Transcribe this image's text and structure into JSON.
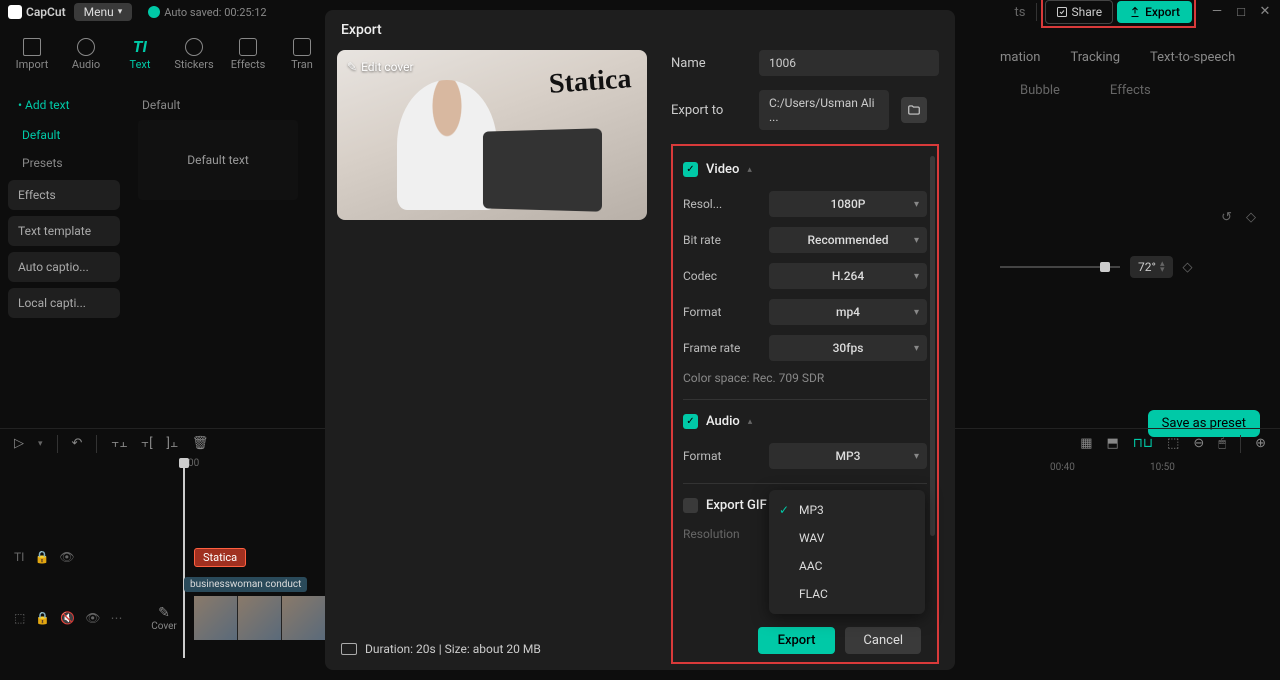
{
  "app": {
    "name": "CapCut",
    "menu": "Menu",
    "auto_saved": "Auto saved: 00:25:12"
  },
  "topbar": {
    "share": "Share",
    "export": "Export"
  },
  "tabs": {
    "import": "Import",
    "audio": "Audio",
    "text": "Text",
    "stickers": "Stickers",
    "effects": "Effects",
    "transitions": "Tran"
  },
  "text_side": {
    "add": "• Add text",
    "default_sub": "Default",
    "presets_sub": "Presets",
    "effects": "Effects",
    "template": "Text template",
    "auto": "Auto captio...",
    "local": "Local capti...",
    "preview_title": "Default",
    "preview_text": "Default text"
  },
  "right": {
    "tab1": "mation",
    "tab2": "Tracking",
    "tab3": "Text-to-speech",
    "sub1": "Bubble",
    "sub2": "Effects",
    "angle": "72°",
    "preset": "Save as preset"
  },
  "modal": {
    "title": "Export",
    "edit_cover": "Edit cover",
    "cover_text": "Statica",
    "name_label": "Name",
    "name_value": "1006",
    "export_to_label": "Export to",
    "export_to_value": "C:/Users/Usman Ali ...",
    "video_section": "Video",
    "res_label": "Resol...",
    "res_value": "1080P",
    "bitrate_label": "Bit rate",
    "bitrate_value": "Recommended",
    "codec_label": "Codec",
    "codec_value": "H.264",
    "format_label": "Format",
    "format_value": "mp4",
    "fps_label": "Frame rate",
    "fps_value": "30fps",
    "color_space": "Color space: Rec. 709 SDR",
    "audio_section": "Audio",
    "audio_format_label": "Format",
    "audio_format_value": "MP3",
    "audio_options": [
      "MP3",
      "WAV",
      "AAC",
      "FLAC"
    ],
    "gif_section": "Export GIF",
    "gif_res_label": "Resolution",
    "export_btn": "Export",
    "cancel_btn": "Cancel",
    "duration": "Duration: 20s | Size: about 20 MB"
  },
  "timeline": {
    "t0": "0:00",
    "t40": "00:40",
    "t50": "10:50",
    "clip_text": "Statica",
    "clip_video": "businesswoman conduct",
    "cover": "Cover"
  }
}
